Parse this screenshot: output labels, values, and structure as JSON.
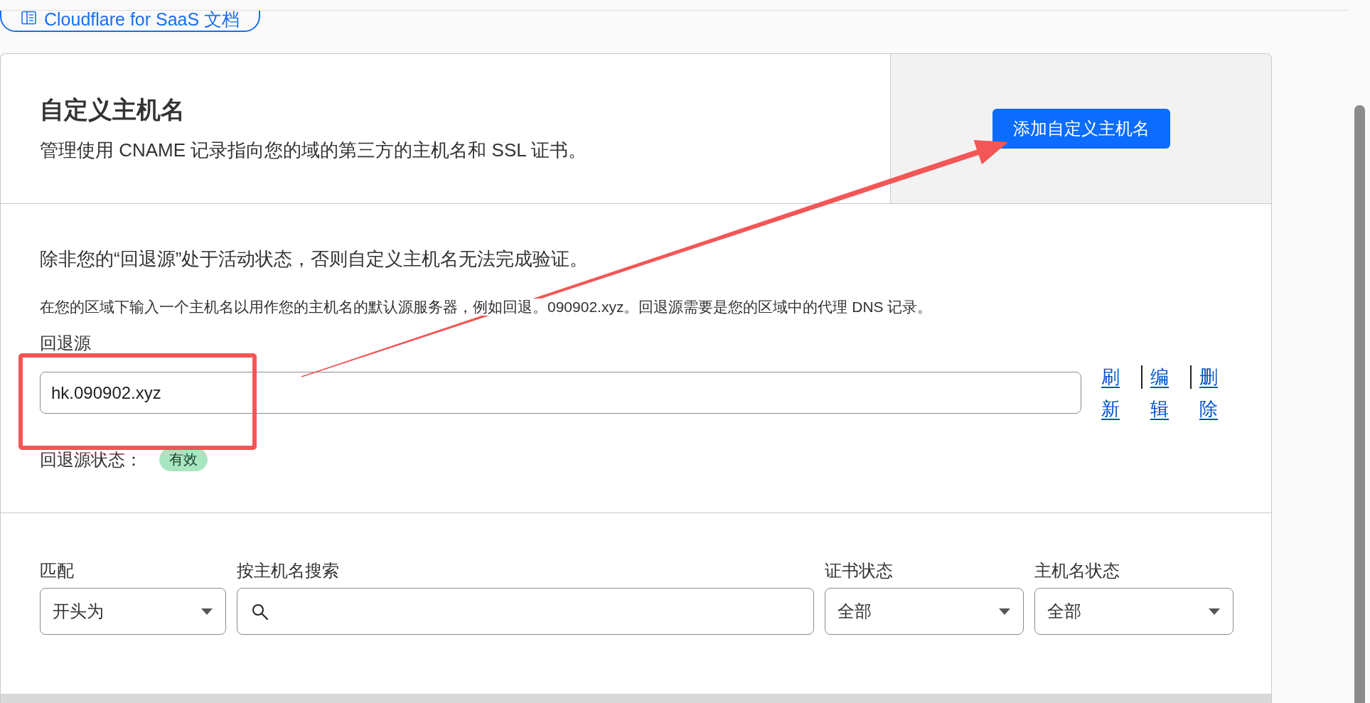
{
  "docs_button": {
    "label": "Cloudflare for SaaS 文档"
  },
  "header": {
    "title": "自定义主机名",
    "description": "管理使用 CNAME 记录指向您的域的第三方的主机名和 SSL 证书。",
    "add_button": "添加自定义主机名"
  },
  "fallback_origin": {
    "notice": "除非您的“回退源”处于活动状态，否则自定义主机名无法完成验证。",
    "help": "在您的区域下输入一个主机名以用作您的主机名的默认源服务器，例如回退。090902.xyz。回退源需要是您的区域中的代理 DNS 记录。",
    "label": "回退源",
    "value": "hk.090902.xyz",
    "actions": [
      "刷新",
      "编辑",
      "删除"
    ],
    "status_label": "回退源状态：",
    "status": "有效"
  },
  "filters": [
    {
      "kind": "select",
      "label": "匹配",
      "value": "开头为"
    },
    {
      "kind": "search",
      "label": "按主机名搜索"
    },
    {
      "kind": "select",
      "label": "证书状态",
      "value": "全部"
    },
    {
      "kind": "select",
      "label": "主机名状态",
      "value": "全部"
    }
  ],
  "annotations": [
    {
      "kind": "rectangle"
    },
    {
      "kind": "arrow"
    }
  ]
}
